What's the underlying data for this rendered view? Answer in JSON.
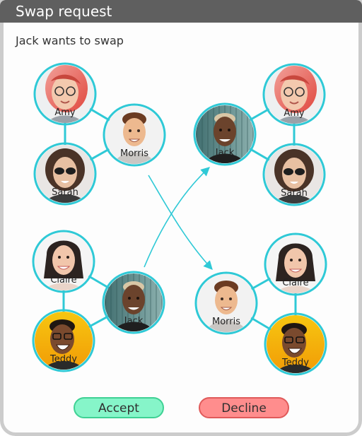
{
  "dialog": {
    "title": "Swap request",
    "message": "Jack wants to swap"
  },
  "colors": {
    "ring": "#2fc9d6",
    "edge": "#2fc9d6",
    "arrow": "#2fc9d6"
  },
  "groups": {
    "before_top": [
      "Amy",
      "Morris",
      "Sarah"
    ],
    "before_bottom": [
      "Claire",
      "Jack",
      "Teddy"
    ],
    "after_top": [
      "Jack",
      "Amy",
      "Sarah"
    ],
    "after_bottom": [
      "Morris",
      "Claire",
      "Teddy"
    ]
  },
  "people": {
    "Amy": {
      "avatar": "woman-red-hair-glasses",
      "label": "Amy"
    },
    "Morris": {
      "avatar": "man-smiling",
      "label": "Morris"
    },
    "Sarah": {
      "avatar": "woman-sunglasses",
      "label": "Sarah"
    },
    "Claire": {
      "avatar": "woman-dark-hair",
      "label": "Claire"
    },
    "Jack": {
      "avatar": "man-dark-skin",
      "label": "Jack"
    },
    "Teddy": {
      "avatar": "man-laughing-yellow",
      "label": "Teddy"
    }
  },
  "actions": {
    "accept": "Accept",
    "decline": "Decline"
  }
}
